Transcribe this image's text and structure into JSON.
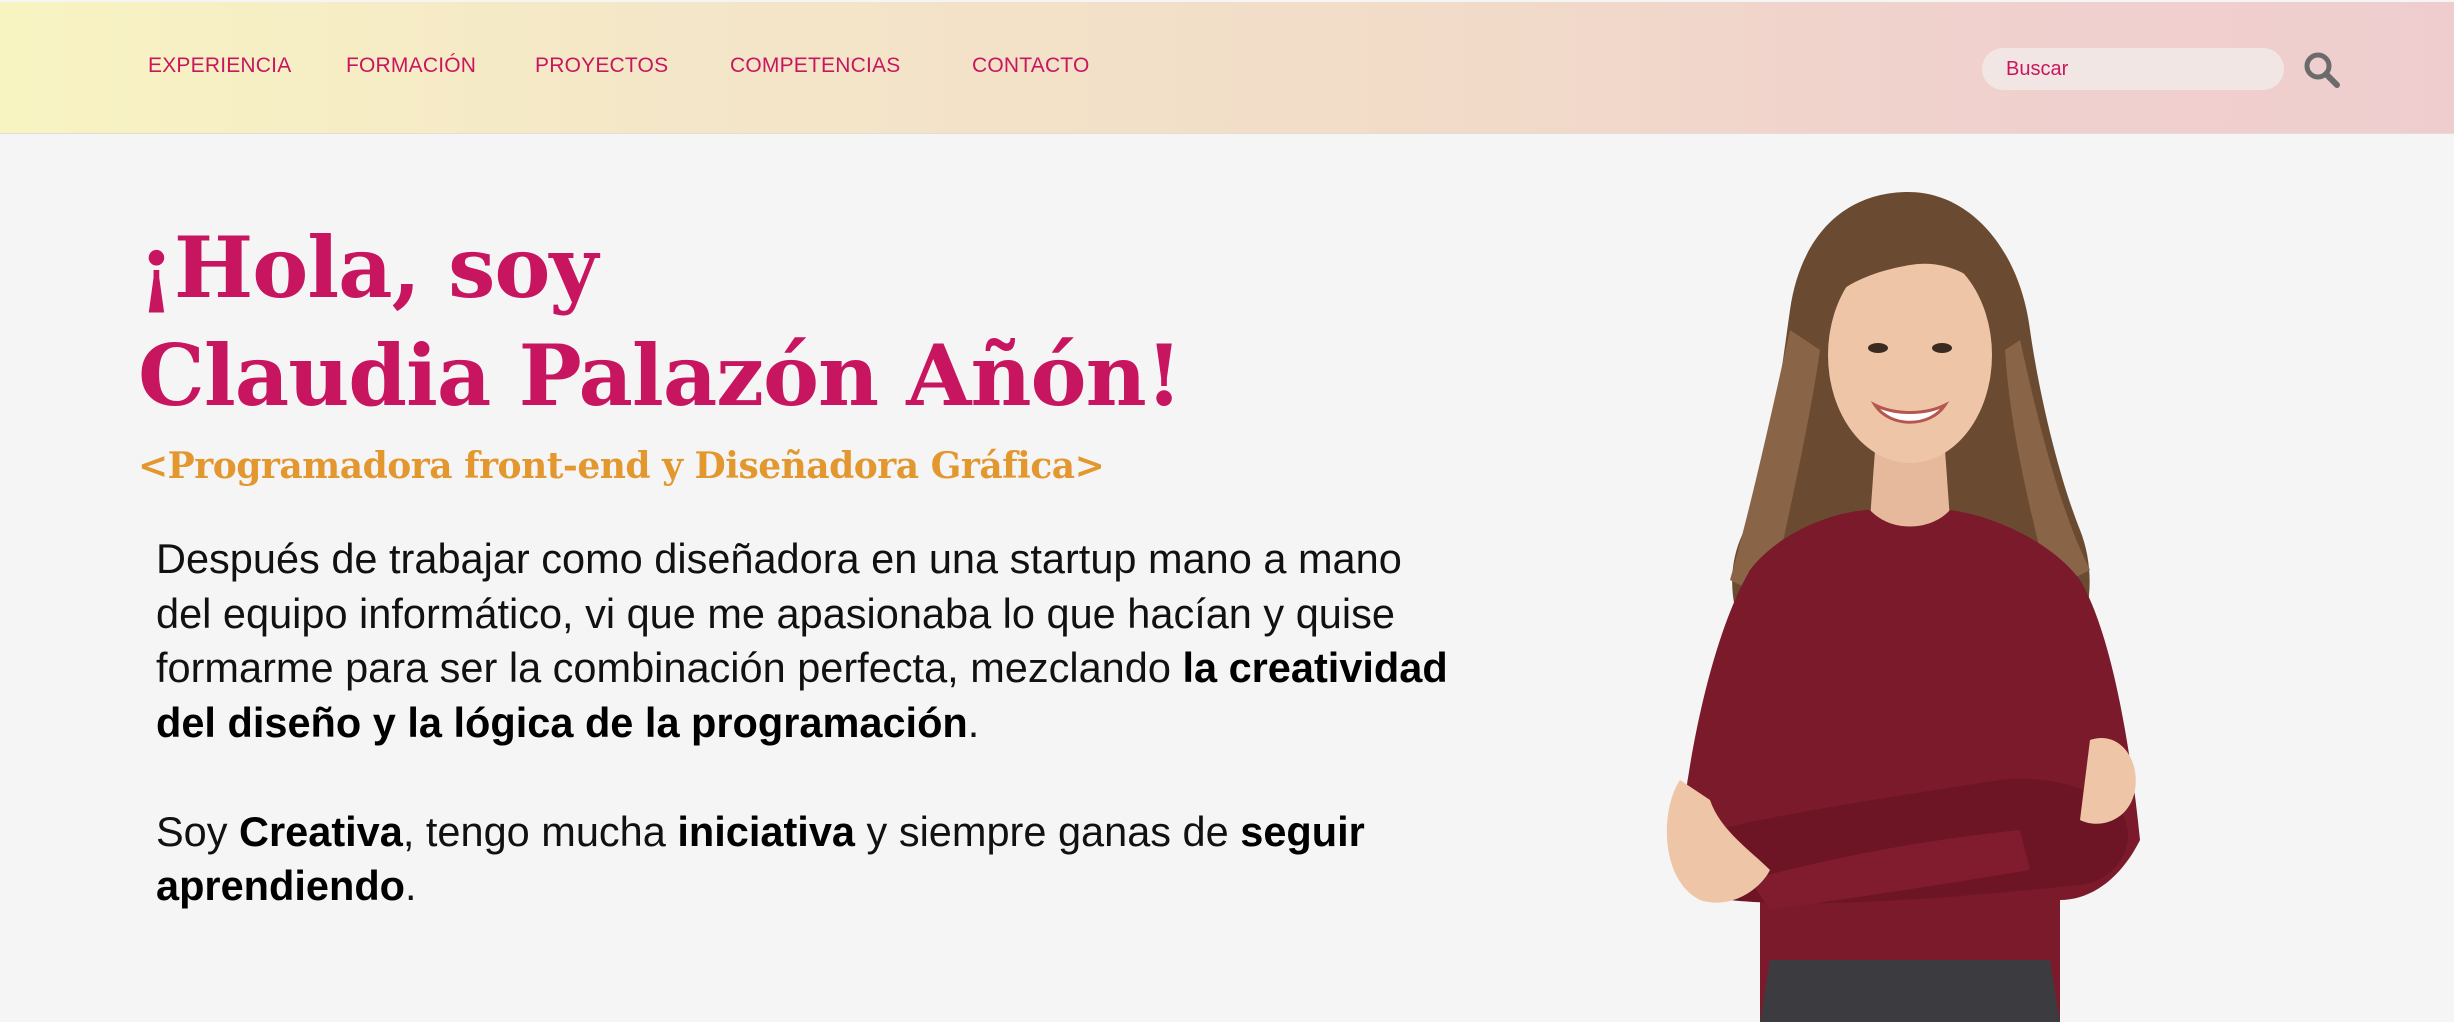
{
  "nav": {
    "items": [
      {
        "label": "EXPERIENCIA"
      },
      {
        "label": "FORMACIÓN"
      },
      {
        "label": "PROYECTOS"
      },
      {
        "label": "COMPETENCIAS"
      },
      {
        "label": "CONTACTO"
      }
    ]
  },
  "search": {
    "placeholder": "Buscar",
    "icon": "search-icon"
  },
  "hero": {
    "title_line1": "¡Hola, soy",
    "title_line2": "Claudia Palazón Añón!",
    "subtitle": "<Programadora front-end y Diseñadora Gráfica>"
  },
  "bio": {
    "p1_l1": "Después de trabajar como diseñadora en una startup mano a mano",
    "p1_l2": "del equipo informático, vi que me apasionaba lo que hacían y quise",
    "p1_l3_a": "formarme para ser la combinación perfecta, mezclando ",
    "p1_l3_b": "la creatividad",
    "p1_l4_b": "del diseño y la lógica de la programación",
    "p1_l4_c": ".",
    "p2_l1_a": "Soy ",
    "p2_l1_b": "Creativa",
    "p2_l1_c": ", tengo mucha ",
    "p2_l1_d": "iniciativa",
    "p2_l1_e": " y siempre ganas de ",
    "p2_l1_f": "seguir",
    "p2_l2_b": "aprendiendo",
    "p2_l2_c": "."
  },
  "colors": {
    "accent": "#c8175f",
    "subtitle": "#e3972f",
    "background": "#f5f5f5",
    "sweater": "#7a1a2a"
  }
}
